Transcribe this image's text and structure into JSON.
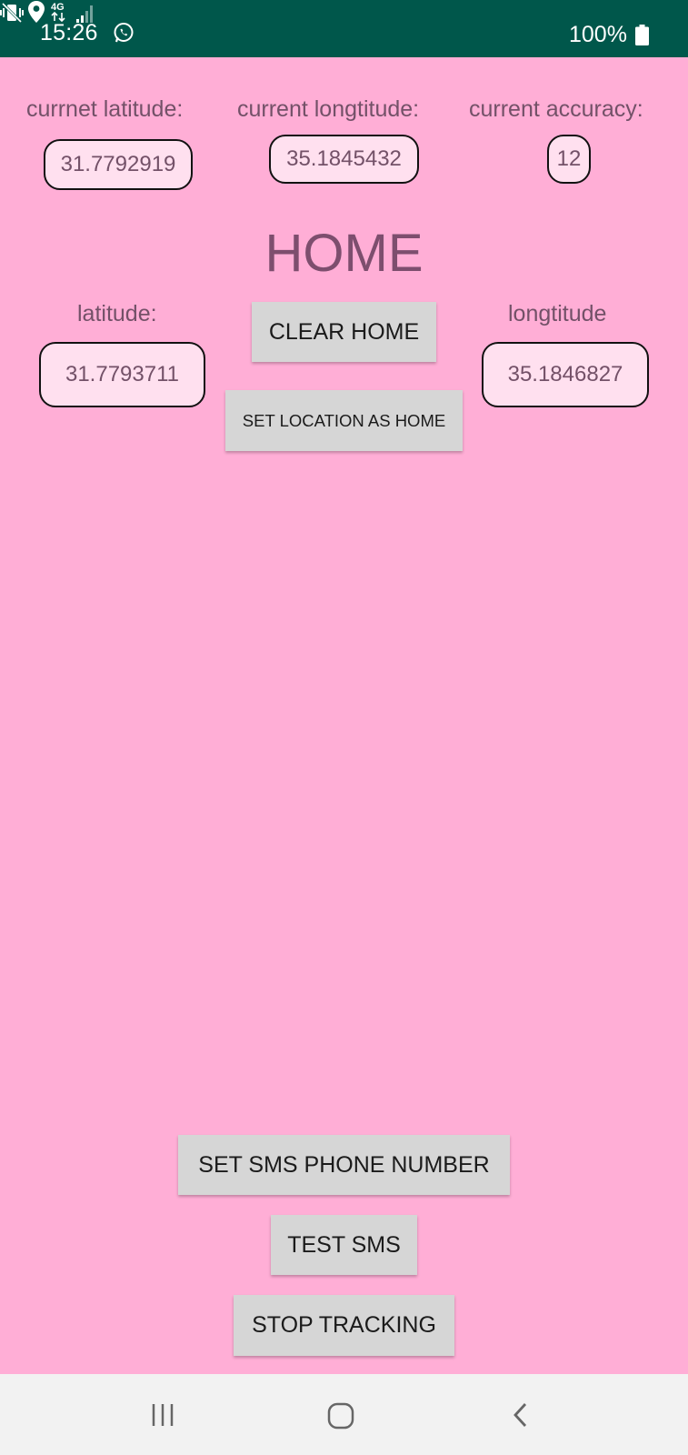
{
  "status_bar": {
    "time": "15:26",
    "battery": "100%",
    "icons": [
      "whatsapp-icon",
      "vibrate-icon",
      "location-icon",
      "network-4g-icon",
      "signal-icon",
      "battery-icon"
    ]
  },
  "current": {
    "latitude_label": "currnet latitude:",
    "latitude_value": "31.7792919",
    "longitude_label": "current longtitude:",
    "longitude_value": "35.1845432",
    "accuracy_label": "current accuracy:",
    "accuracy_value": "12"
  },
  "home": {
    "title": "HOME",
    "latitude_label": "latitude:",
    "latitude_value": "31.7793711",
    "longitude_label": "longtitude",
    "longitude_value": "35.1846827",
    "clear_button": "CLEAR HOME",
    "set_button": "SET LOCATION AS HOME"
  },
  "actions": {
    "set_sms": "SET SMS PHONE NUMBER",
    "test_sms": "TEST SMS",
    "stop_tracking": "STOP TRACKING"
  },
  "nav_bar": {
    "icons": [
      "recent-apps-icon",
      "home-icon",
      "back-icon"
    ]
  },
  "colors": {
    "status_bar": "#00574b",
    "background": "#ffaed6",
    "value_box": "#ffe0ef",
    "text": "#735168",
    "button": "#d6d6d6"
  }
}
